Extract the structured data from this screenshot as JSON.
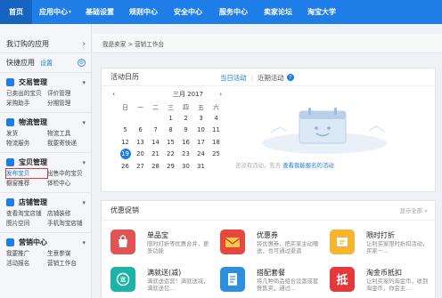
{
  "topnav": {
    "tabs": [
      {
        "label": "首页",
        "caret": ""
      },
      {
        "label": "应用中心",
        "caret": "▾"
      },
      {
        "label": "基础设置",
        "caret": ""
      },
      {
        "label": "规则中心",
        "caret": ""
      },
      {
        "label": "安全中心",
        "caret": ""
      },
      {
        "label": "服务中心",
        "caret": ""
      },
      {
        "label": "卖家论坛",
        "caret": ""
      },
      {
        "label": "淘宝大学",
        "caret": ""
      }
    ]
  },
  "sidebar": {
    "my_apps": "我订购的应用",
    "quick_apps": "快捷应用",
    "settings": "设置",
    "sections": [
      {
        "title": "交易管理",
        "items": [
          "已卖出的宝贝",
          "评价管理",
          "采购助手",
          "分期管理"
        ]
      },
      {
        "title": "物流管理",
        "items": [
          "发货",
          "物流工具",
          "物流服务",
          "我要寄快递"
        ]
      },
      {
        "title": "宝贝管理",
        "items": [
          "发布宝贝",
          "出售中的宝贝",
          "橱窗推荐",
          "体检中心"
        ]
      },
      {
        "title": "店铺管理",
        "items": [
          "查看淘宝店铺",
          "店铺装修",
          "图片空间",
          "手机淘宝店铺"
        ]
      },
      {
        "title": "营销中心",
        "items": [
          "我要推广",
          "生意参谋",
          "活动报名",
          "营销工作台"
        ]
      }
    ]
  },
  "breadcrumb": "我是卖家 > 营销工作台",
  "calendar": {
    "title": "活动日历",
    "prev": "‹",
    "next": "›",
    "month": "三月 2017",
    "weekdays": [
      "日",
      "一",
      "二",
      "三",
      "四",
      "五",
      "六"
    ],
    "weeks": [
      [
        "",
        "",
        "",
        "1",
        "2",
        "3",
        "4"
      ],
      [
        "5",
        "6",
        "7",
        "8",
        "9",
        "10",
        "11"
      ],
      [
        "12",
        "13",
        "14",
        "15",
        "16",
        "17",
        "18"
      ],
      [
        "19",
        "20",
        "21",
        "22",
        "23",
        "24",
        "25"
      ],
      [
        "26",
        "27",
        "28",
        "29",
        "30",
        "31",
        ""
      ]
    ],
    "today": "19"
  },
  "activities": {
    "tab_today": "当日活动",
    "tab_recent": "近期活动",
    "empty_text": "还没有活动，先去",
    "link": "查看我能报名的活动"
  },
  "promo": {
    "title": "优惠促销",
    "more": "显示全部 »",
    "tiles": [
      {
        "name": "单品宝",
        "desc": "限时打折等优惠合并，更多功能",
        "icon": "shopping-bag-icon",
        "color": "#e25454"
      },
      {
        "name": "优惠券",
        "desc": "将优惠券，把买家主动赠送，也可通过渠道",
        "icon": "envelope-icon",
        "color": "#e8473e"
      },
      {
        "name": "限时打折",
        "desc": "让利买家限时折扣活动，买家一...",
        "icon": "ticket-icon",
        "color": "#f5b52e"
      },
      {
        "name": "满就送(减)",
        "desc": "满就送运营！满就送减，满就送包...",
        "icon": "gift-icon",
        "color": "#1fb3a8"
      },
      {
        "name": "搭配套餐",
        "desc": "将几种商品组合设置成套餐售卖，通过...",
        "icon": "document-icon",
        "color": "#2d8fe0"
      },
      {
        "name": "淘金币抵扣",
        "desc": "让利买家的淘金币，收到淘金币，你会主...",
        "icon": "coin-icon",
        "color": "#e23a3a"
      }
    ]
  }
}
